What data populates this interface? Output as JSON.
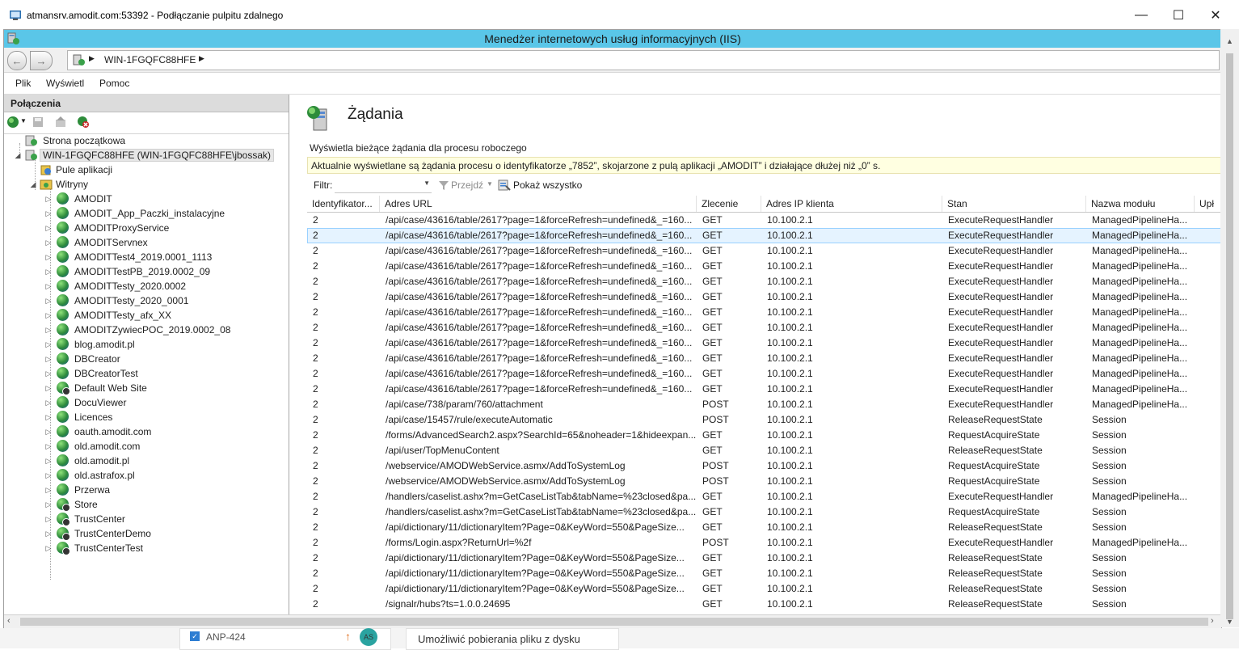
{
  "rdp": {
    "title": "atmansrv.amodit.com:53392 - Podłączanie pulpitu zdalnego",
    "minimize": "—",
    "maximize": "☐",
    "close": "✕"
  },
  "iis": {
    "title": "Menedżer internetowych usług informacyjnych (IIS)",
    "address": "WIN-1FGQFC88HFE",
    "menu": [
      "Plik",
      "Wyświetl",
      "Pomoc"
    ]
  },
  "connections": {
    "header": "Połączenia",
    "start_page": "Strona początkowa",
    "server": "WIN-1FGQFC88HFE (WIN-1FGQFC88HFE\\jbossak)",
    "app_pools": "Pule aplikacji",
    "sites_label": "Witryny",
    "sites": [
      {
        "name": "AMODIT",
        "stopped": false
      },
      {
        "name": "AMODIT_App_Paczki_instalacyjne",
        "stopped": false
      },
      {
        "name": "AMODITProxyService",
        "stopped": false
      },
      {
        "name": "AMODITServnex",
        "stopped": false
      },
      {
        "name": "AMODITTest4_2019.0001_1113",
        "stopped": false
      },
      {
        "name": "AMODITTestPB_2019.0002_09",
        "stopped": false
      },
      {
        "name": "AMODITTesty_2020.0002",
        "stopped": false
      },
      {
        "name": "AMODITTesty_2020_0001",
        "stopped": false
      },
      {
        "name": "AMODITTesty_afx_XX",
        "stopped": false
      },
      {
        "name": "AMODITZywiecPOC_2019.0002_08",
        "stopped": false
      },
      {
        "name": "blog.amodit.pl",
        "stopped": false
      },
      {
        "name": "DBCreator",
        "stopped": false
      },
      {
        "name": "DBCreatorTest",
        "stopped": false
      },
      {
        "name": "Default Web Site",
        "stopped": true
      },
      {
        "name": "DocuViewer",
        "stopped": false
      },
      {
        "name": "Licences",
        "stopped": false
      },
      {
        "name": "oauth.amodit.com",
        "stopped": false
      },
      {
        "name": "old.amodit.com",
        "stopped": false
      },
      {
        "name": "old.amodit.pl",
        "stopped": false
      },
      {
        "name": "old.astrafox.pl",
        "stopped": false
      },
      {
        "name": "Przerwa",
        "stopped": false
      },
      {
        "name": "Store",
        "stopped": true
      },
      {
        "name": "TrustCenter",
        "stopped": true
      },
      {
        "name": "TrustCenterDemo",
        "stopped": true
      },
      {
        "name": "TrustCenterTest",
        "stopped": true
      }
    ]
  },
  "page": {
    "title": "Żądania",
    "description": "Wyświetla bieżące żądania dla procesu roboczego",
    "info": "Aktualnie wyświetlane są żądania procesu o identyfikatorze „7852”, skojarzone z pulą aplikacji „AMODIT” i działające dłużej niż „0” s.",
    "filter_label": "Filtr:",
    "go_label": "Przejdź",
    "show_all_label": "Pokaż wszystko"
  },
  "table": {
    "columns": [
      "Identyfikator...",
      "Adres URL",
      "Zlecenie",
      "Adres IP klienta",
      "Stan",
      "Nazwa modułu",
      "Upł"
    ],
    "rows": [
      [
        "2",
        "/api/case/43616/table/2617?page=1&forceRefresh=undefined&_=160...",
        "GET",
        "10.100.2.1",
        "ExecuteRequestHandler",
        "ManagedPipelineHa..."
      ],
      [
        "2",
        "/api/case/43616/table/2617?page=1&forceRefresh=undefined&_=160...",
        "GET",
        "10.100.2.1",
        "ExecuteRequestHandler",
        "ManagedPipelineHa..."
      ],
      [
        "2",
        "/api/case/43616/table/2617?page=1&forceRefresh=undefined&_=160...",
        "GET",
        "10.100.2.1",
        "ExecuteRequestHandler",
        "ManagedPipelineHa..."
      ],
      [
        "2",
        "/api/case/43616/table/2617?page=1&forceRefresh=undefined&_=160...",
        "GET",
        "10.100.2.1",
        "ExecuteRequestHandler",
        "ManagedPipelineHa..."
      ],
      [
        "2",
        "/api/case/43616/table/2617?page=1&forceRefresh=undefined&_=160...",
        "GET",
        "10.100.2.1",
        "ExecuteRequestHandler",
        "ManagedPipelineHa..."
      ],
      [
        "2",
        "/api/case/43616/table/2617?page=1&forceRefresh=undefined&_=160...",
        "GET",
        "10.100.2.1",
        "ExecuteRequestHandler",
        "ManagedPipelineHa..."
      ],
      [
        "2",
        "/api/case/43616/table/2617?page=1&forceRefresh=undefined&_=160...",
        "GET",
        "10.100.2.1",
        "ExecuteRequestHandler",
        "ManagedPipelineHa..."
      ],
      [
        "2",
        "/api/case/43616/table/2617?page=1&forceRefresh=undefined&_=160...",
        "GET",
        "10.100.2.1",
        "ExecuteRequestHandler",
        "ManagedPipelineHa..."
      ],
      [
        "2",
        "/api/case/43616/table/2617?page=1&forceRefresh=undefined&_=160...",
        "GET",
        "10.100.2.1",
        "ExecuteRequestHandler",
        "ManagedPipelineHa..."
      ],
      [
        "2",
        "/api/case/43616/table/2617?page=1&forceRefresh=undefined&_=160...",
        "GET",
        "10.100.2.1",
        "ExecuteRequestHandler",
        "ManagedPipelineHa..."
      ],
      [
        "2",
        "/api/case/43616/table/2617?page=1&forceRefresh=undefined&_=160...",
        "GET",
        "10.100.2.1",
        "ExecuteRequestHandler",
        "ManagedPipelineHa..."
      ],
      [
        "2",
        "/api/case/43616/table/2617?page=1&forceRefresh=undefined&_=160...",
        "GET",
        "10.100.2.1",
        "ExecuteRequestHandler",
        "ManagedPipelineHa..."
      ],
      [
        "2",
        "/api/case/738/param/760/attachment",
        "POST",
        "10.100.2.1",
        "ExecuteRequestHandler",
        "ManagedPipelineHa..."
      ],
      [
        "2",
        "/api/case/15457/rule/executeAutomatic",
        "POST",
        "10.100.2.1",
        "ReleaseRequestState",
        "Session"
      ],
      [
        "2",
        "/forms/AdvancedSearch2.aspx?SearchId=65&noheader=1&hideexpan...",
        "GET",
        "10.100.2.1",
        "RequestAcquireState",
        "Session"
      ],
      [
        "2",
        "/api/user/TopMenuContent",
        "GET",
        "10.100.2.1",
        "ReleaseRequestState",
        "Session"
      ],
      [
        "2",
        "/webservice/AMODWebService.asmx/AddToSystemLog",
        "POST",
        "10.100.2.1",
        "RequestAcquireState",
        "Session"
      ],
      [
        "2",
        "/webservice/AMODWebService.asmx/AddToSystemLog",
        "POST",
        "10.100.2.1",
        "RequestAcquireState",
        "Session"
      ],
      [
        "2",
        "/handlers/caselist.ashx?m=GetCaseListTab&tabName=%23closed&pa...",
        "GET",
        "10.100.2.1",
        "ExecuteRequestHandler",
        "ManagedPipelineHa..."
      ],
      [
        "2",
        "/handlers/caselist.ashx?m=GetCaseListTab&tabName=%23closed&pa...",
        "GET",
        "10.100.2.1",
        "RequestAcquireState",
        "Session"
      ],
      [
        "2",
        "/api/dictionary/11/dictionaryItem?Page=0&KeyWord=550&PageSize...",
        "GET",
        "10.100.2.1",
        "ReleaseRequestState",
        "Session"
      ],
      [
        "2",
        "/forms/Login.aspx?ReturnUrl=%2f",
        "POST",
        "10.100.2.1",
        "ExecuteRequestHandler",
        "ManagedPipelineHa..."
      ],
      [
        "2",
        "/api/dictionary/11/dictionaryItem?Page=0&KeyWord=550&PageSize...",
        "GET",
        "10.100.2.1",
        "ReleaseRequestState",
        "Session"
      ],
      [
        "2",
        "/api/dictionary/11/dictionaryItem?Page=0&KeyWord=550&PageSize...",
        "GET",
        "10.100.2.1",
        "ReleaseRequestState",
        "Session"
      ],
      [
        "2",
        "/api/dictionary/11/dictionaryItem?Page=0&KeyWord=550&PageSize...",
        "GET",
        "10.100.2.1",
        "ReleaseRequestState",
        "Session"
      ],
      [
        "2",
        "/signalr/hubs?ts=1.0.0.24695",
        "GET",
        "10.100.2.1",
        "ReleaseRequestState",
        "Session"
      ]
    ],
    "selected_row": 1
  },
  "background": {
    "ticket": "ANP-424",
    "avatar": "AS",
    "task_text": "Umożliwić pobierania pliku z dysku"
  },
  "colors": {
    "iis_titlebar": "#5ac6e8",
    "info_bg": "#ffffe1",
    "selected_row_bg": "#e5f3ff",
    "selected_row_border": "#99d1ff"
  }
}
